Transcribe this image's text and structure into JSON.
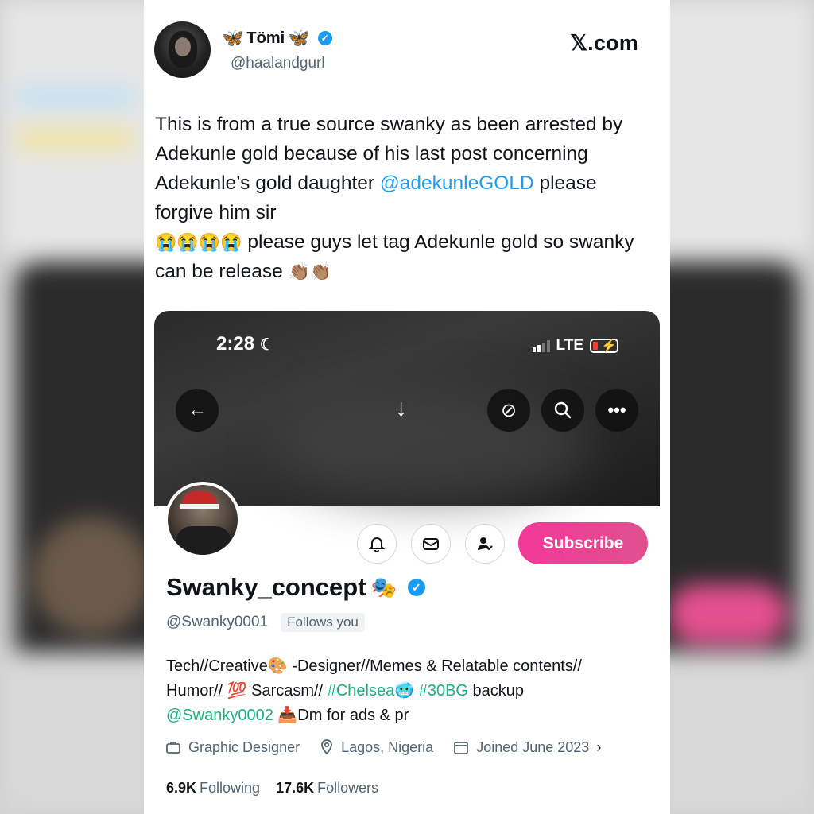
{
  "post": {
    "author_name": "Tömi",
    "author_handle": "@haalandgurl",
    "site": "𝕏.com",
    "text_part1": "This is from a true source swanky as been arrested by Adekunle gold because of his last post concerning Adekunle’s gold daughter",
    "mention": "@adekunleGOLD",
    "text_part2": " please forgive him sir",
    "text_part3": " please guys let tag Adekunle gold so swanky can be release ",
    "crying_emojis": "😭😭😭😭",
    "clap_emojis": "👏🏽👏🏽"
  },
  "phone": {
    "time": "2:28",
    "network": "LTE"
  },
  "profile": {
    "name": "Swanky_concept",
    "name_emoji": "🎭",
    "handle": "@Swanky0001",
    "follows_you": "Follows you",
    "subscribe_label": "Subscribe",
    "bio": {
      "line1": "Tech//Creative🎨 -Designer//Memes & Relatable contents//",
      "line2a": "Humor// 💯 Sarcasm// ",
      "hashtag1": "#Chelsea",
      "emoji_cold": "🥶",
      "hashtag2": "#30BG",
      "line2b": " backup",
      "mention": "@Swanky0002",
      "line3": " 📥Dm for ads & pr"
    },
    "job": "Graphic Designer",
    "location": "Lagos, Nigeria",
    "joined": "Joined June 2023",
    "following_count": "6.9K",
    "following_label": "Following",
    "followers_count": "17.6K",
    "followers_label": "Followers"
  },
  "colors": {
    "link": "#1d9bf0",
    "hashtag": "#1bb07a",
    "subscribe": "#f3389a",
    "verified": "#1d9bf0"
  }
}
